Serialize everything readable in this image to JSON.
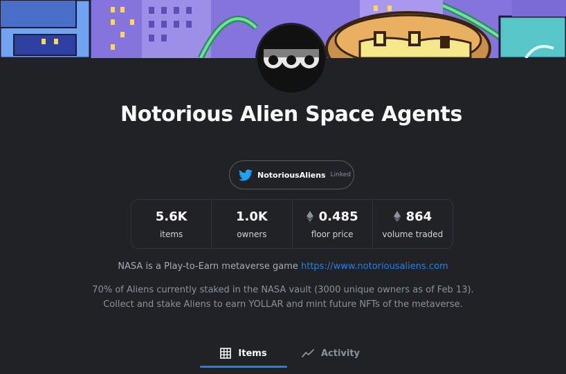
{
  "collection": {
    "title": "Notorious Alien Space Agents",
    "twitter": {
      "handle": "NotoriousAliens",
      "status": "Linked"
    },
    "stats": [
      {
        "value": "5.6K",
        "label": "items",
        "eth": false
      },
      {
        "value": "1.0K",
        "label": "owners",
        "eth": false
      },
      {
        "value": "0.485",
        "label": "floor price",
        "eth": true
      },
      {
        "value": "864",
        "label": "volume traded",
        "eth": true
      }
    ],
    "description_intro": "NASA is a Play-to-Earn metaverse game",
    "description_link": "https://www.notoriousaliens.com",
    "description_body": "70% of Aliens currently staked in the NASA vault (3000 unique owners as of Feb 13). Collect and stake Aliens to earn YOLLAR and mint future NFTs of the metaverse."
  },
  "tabs": [
    {
      "label": "Items",
      "icon": "grid-icon",
      "active": true
    },
    {
      "label": "Activity",
      "icon": "activity-icon",
      "active": false
    }
  ],
  "colors": {
    "background": "#202225",
    "accent": "#2081e2",
    "twitter": "#1da1f2"
  }
}
